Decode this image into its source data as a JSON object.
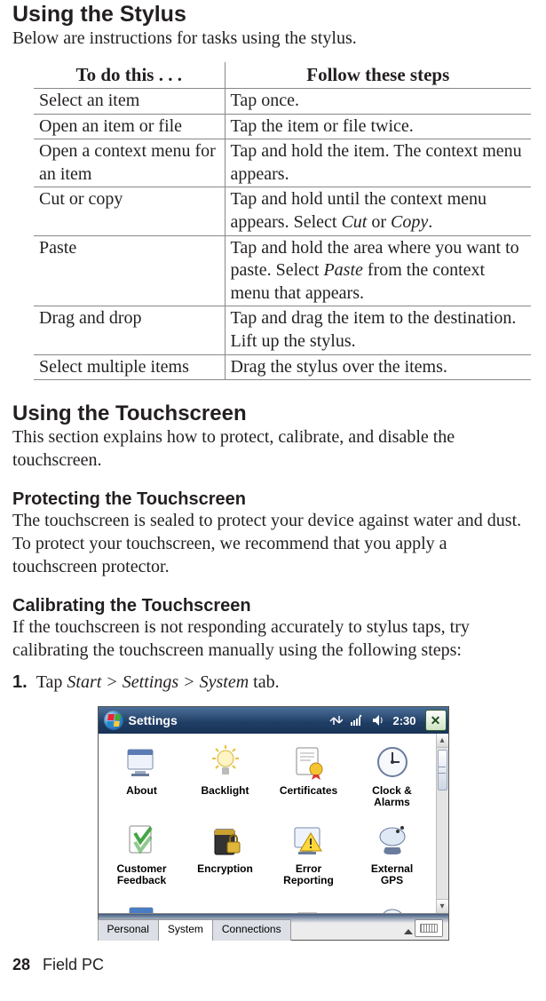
{
  "headingStylus": "Using the Stylus",
  "introStylus": "Below are instructions for tasks using the stylus.",
  "table": {
    "headerLeft": "To do this . . .",
    "headerRight": "Follow these steps",
    "rows": [
      {
        "l": "Select an item",
        "r": "Tap once."
      },
      {
        "l": "Open an item or file",
        "r": "Tap the item or file twice."
      },
      {
        "l": "Open a context menu for an item",
        "r": "Tap and hold the item. The context menu appears."
      },
      {
        "l": "Cut or copy",
        "r_pre": "Tap and hold until the context menu appears. Select ",
        "r_i1": "Cut",
        "r_mid": " or ",
        "r_i2": "Copy",
        "r_post": "."
      },
      {
        "l": "Paste",
        "r_pre": "Tap and hold the area where you want to paste. Select ",
        "r_i1": "Paste",
        "r_post": " from the context menu that appears."
      },
      {
        "l": "Drag and drop",
        "r": "Tap and drag the item to the destination. Lift up the stylus."
      },
      {
        "l": "Select multiple items",
        "r": "Drag the stylus over the items."
      }
    ]
  },
  "headingTouch": "Using the Touchscreen",
  "touchIntro": "This section explains how to protect, calibrate, and disable the touchscreen.",
  "headingProtect": "Protecting the Touchscreen",
  "protectBody": "The touchscreen is sealed to protect your device against water and dust. To protect your touchscreen, we recommend that you apply a touchscreen protector.",
  "headingCalibrate": "Calibrating the Touchscreen",
  "calibrateBody": "If the touchscreen is not responding accurately to stylus taps, try calibrating the touchscreen manually using the following steps:",
  "step1_num": "1.",
  "step1_pre": "Tap ",
  "step1_i": "Start > Settings > System",
  "step1_post": " tab.",
  "device": {
    "title": "Settings",
    "clock": "2:30",
    "closeGlyph": "✕",
    "tabs": {
      "personal": "Personal",
      "system": "System",
      "connections": "Connections"
    },
    "apps": {
      "about": "About",
      "backlight": "Backlight",
      "certificates": "Certificates",
      "clockAlarms": "Clock &\nAlarms",
      "customerFeedback": "Customer\nFeedback",
      "encryption": "Encryption",
      "errorReporting": "Error\nReporting",
      "externalGps": "External\nGPS"
    }
  },
  "footer": {
    "page": "28",
    "label": "Field PC"
  }
}
